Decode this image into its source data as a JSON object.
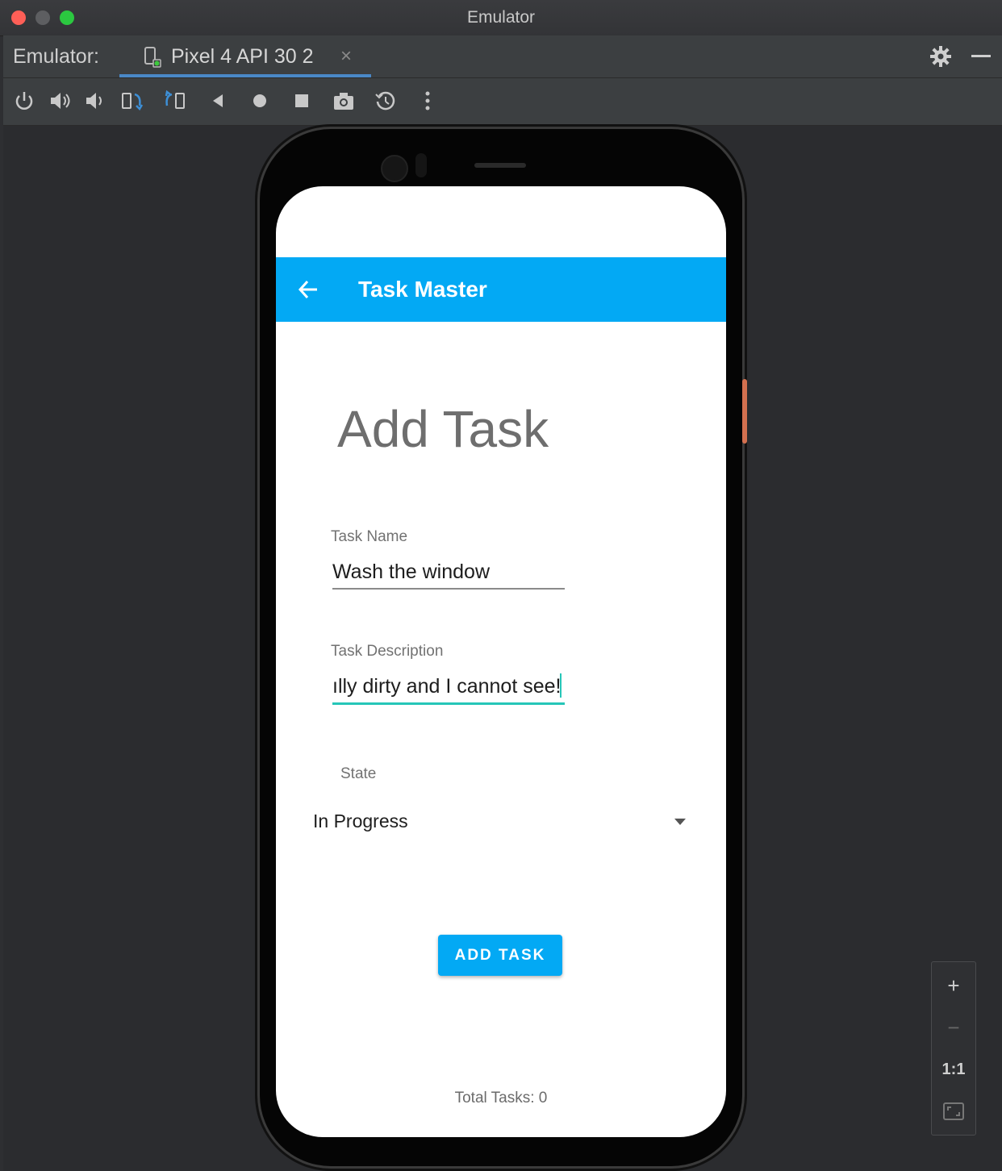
{
  "window": {
    "title": "Emulator"
  },
  "tabbar": {
    "prefix": "Emulator:",
    "tab_label": "Pixel 4 API 30 2",
    "close_glyph": "×"
  },
  "toolbar": {
    "icons": [
      "power-icon",
      "volume-up-icon",
      "volume-down-icon",
      "rotate-left-icon",
      "rotate-right-icon",
      "back-icon",
      "home-icon",
      "overview-icon",
      "screenshot-icon",
      "snapshot-icon",
      "more-icon"
    ]
  },
  "app": {
    "title": "Task Master",
    "heading": "Add Task",
    "task_name_label": "Task Name",
    "task_name_value": "Wash the window",
    "task_desc_label": "Task Description",
    "task_desc_value": "ılly dirty and I cannot see!",
    "state_label": "State",
    "state_value": "In Progress",
    "add_button": "ADD TASK",
    "total_tasks": "Total Tasks: 0",
    "colors": {
      "primary": "#03a9f4",
      "focus_accent": "#26c6b8"
    }
  },
  "zoom": {
    "zoom_in": "+",
    "zoom_out": "−",
    "actual_size": "1:1"
  }
}
